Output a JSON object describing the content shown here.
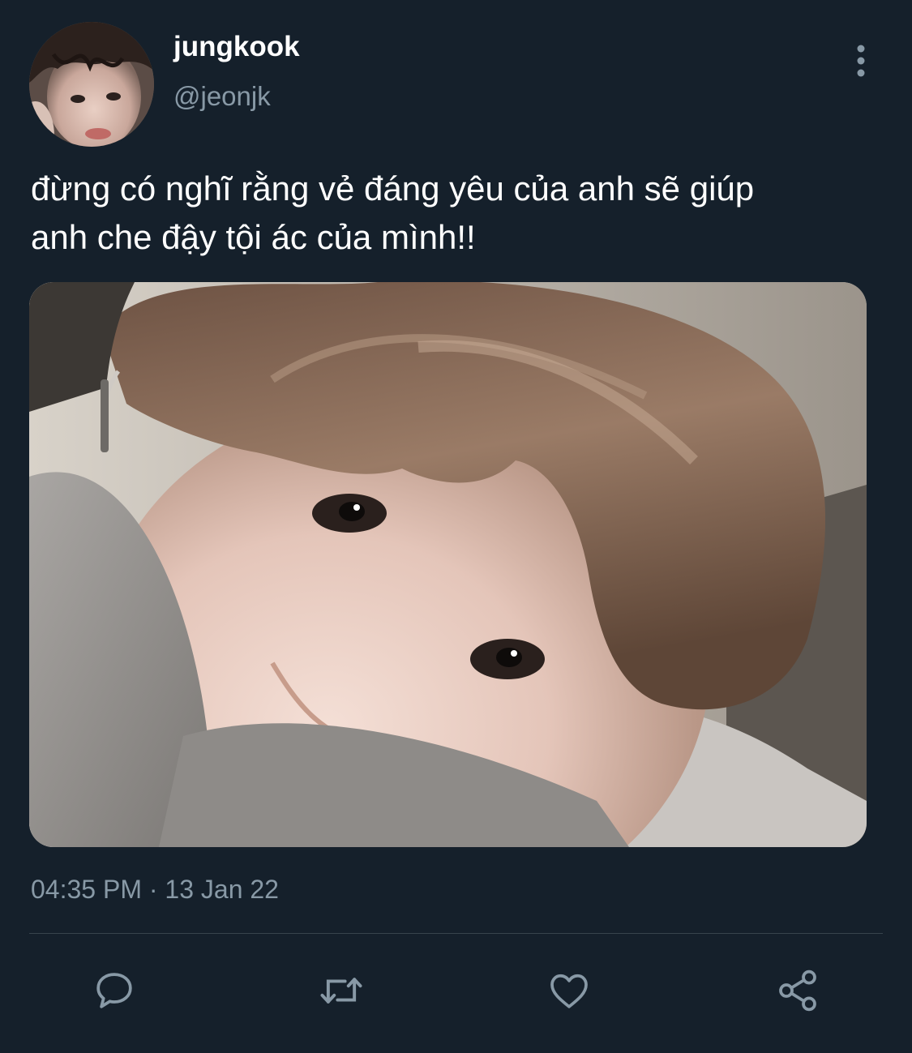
{
  "tweet": {
    "display_name": "jungkook",
    "handle": "@jeonjk",
    "text_lines": [
      "đừng có nghĩ rằng vẻ đáng yêu của anh sẽ giúp",
      "anh che đậy tội ác của mình!!"
    ],
    "time": "04:35 PM",
    "separator": "·",
    "date": "13 Jan 22"
  },
  "icons": {
    "more": "more-vertical-icon",
    "reply": "reply-icon",
    "retweet": "retweet-icon",
    "like": "heart-icon",
    "share": "share-icon"
  },
  "colors": {
    "background": "#15202b",
    "primary_text": "#ffffff",
    "secondary_text": "#8899a6",
    "divider": "#38444d"
  }
}
